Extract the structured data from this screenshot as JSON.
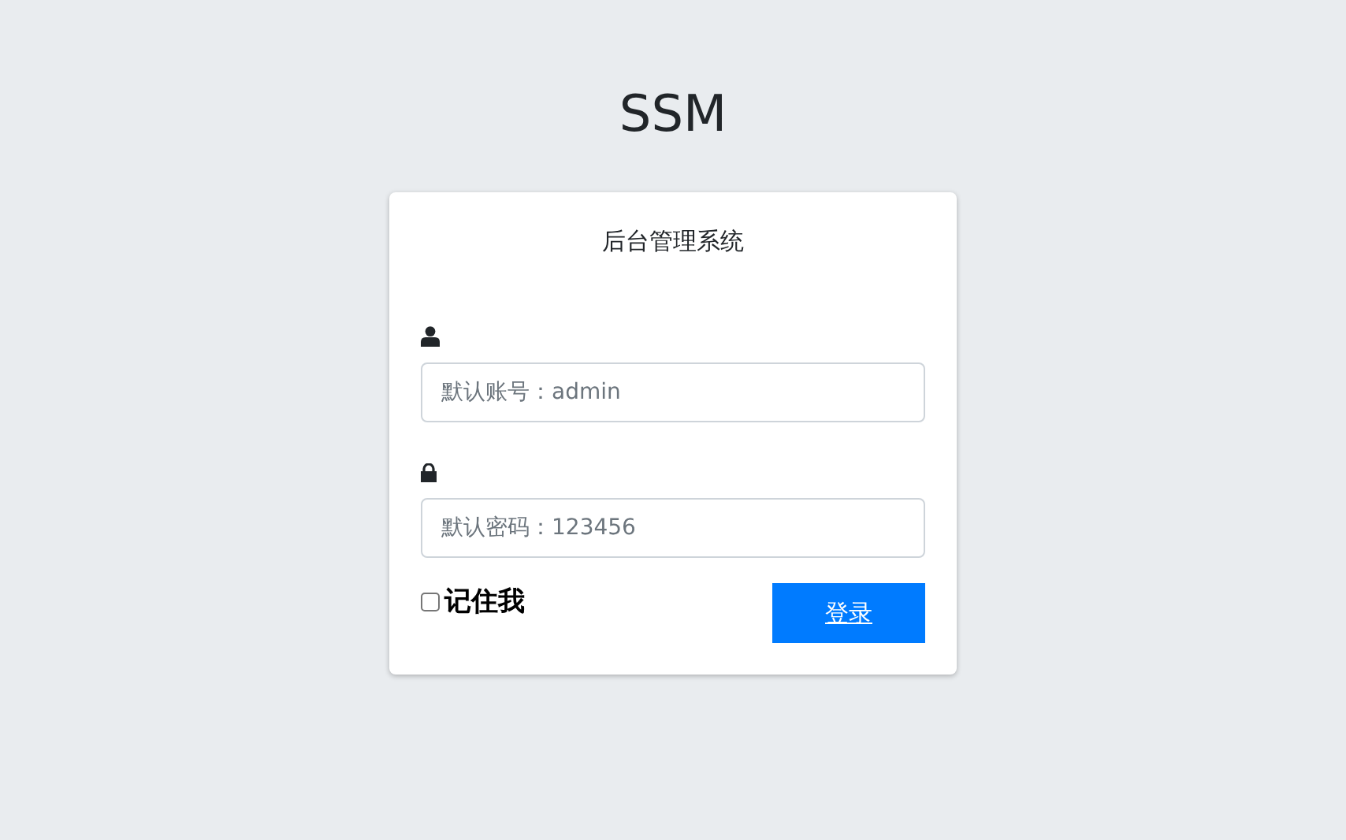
{
  "app_title": "SSM",
  "login_card": {
    "title": "后台管理系统",
    "fields": [
      {
        "kind": "user",
        "placeholder": "默认账号：admin"
      },
      {
        "kind": "password",
        "placeholder": "默认密码：123456"
      }
    ],
    "remember": {
      "label": "记住我",
      "checked": false
    },
    "submit": "登录"
  }
}
